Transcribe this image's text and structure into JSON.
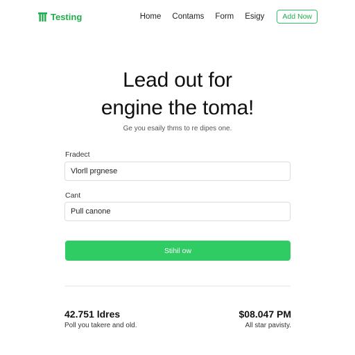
{
  "brand": {
    "name": "Testing",
    "icon": "brand-logo-icon",
    "color": "#1fae4a"
  },
  "nav": {
    "items": [
      {
        "label": "Home"
      },
      {
        "label": "Contams"
      },
      {
        "label": "Form"
      },
      {
        "label": "Esigy"
      }
    ],
    "cta_label": "Add Now"
  },
  "hero": {
    "title_line1": "Lead out for",
    "title_line2": "engine the toma!",
    "subtitle": "Ge you esaily thms to re dipes one."
  },
  "form": {
    "field1": {
      "label": "Fradect",
      "value": "Vlorll prgnese"
    },
    "field2": {
      "label": "Cant",
      "value": "Pull canone"
    },
    "submit_label": "Stihil ow",
    "accent": "#2ecc62"
  },
  "stats": [
    {
      "value": "42.751 ldres",
      "caption": "Poll you takere and old."
    },
    {
      "value": "$08.047 PM",
      "caption": "All star pavisty."
    }
  ]
}
